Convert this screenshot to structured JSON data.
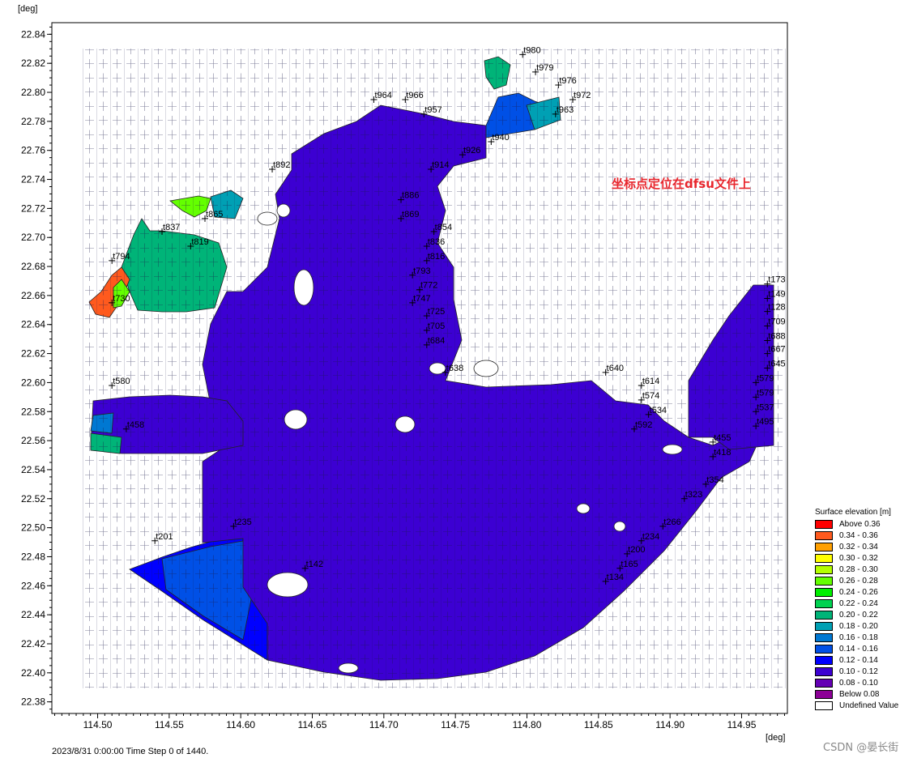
{
  "map": {
    "y_unit": "[deg]",
    "x_unit": "[deg]",
    "x_ticks": [
      "114.50",
      "114.55",
      "114.60",
      "114.65",
      "114.70",
      "114.75",
      "114.80",
      "114.85",
      "114.90",
      "114.95"
    ],
    "y_ticks": [
      "22.84",
      "22.82",
      "22.80",
      "22.78",
      "22.76",
      "22.74",
      "22.72",
      "22.70",
      "22.68",
      "22.66",
      "22.64",
      "22.62",
      "22.60",
      "22.58",
      "22.56",
      "22.54",
      "22.52",
      "22.50",
      "22.48",
      "22.46",
      "22.44",
      "22.42",
      "22.40",
      "22.38"
    ],
    "xlim": [
      114.468,
      114.982
    ],
    "ylim": [
      22.372,
      22.848
    ],
    "annotation": "坐标点定位在dfsu文件上",
    "point_labels": [
      {
        "text": "t980",
        "lon": 114.797,
        "lat": 22.826
      },
      {
        "text": "t979",
        "lon": 114.806,
        "lat": 22.814
      },
      {
        "text": "t976",
        "lon": 114.822,
        "lat": 22.805
      },
      {
        "text": "t972",
        "lon": 114.832,
        "lat": 22.795
      },
      {
        "text": "t963",
        "lon": 114.82,
        "lat": 22.785
      },
      {
        "text": "t966",
        "lon": 114.715,
        "lat": 22.795
      },
      {
        "text": "t964",
        "lon": 114.693,
        "lat": 22.795
      },
      {
        "text": "t957",
        "lon": 114.728,
        "lat": 22.785
      },
      {
        "text": "t940",
        "lon": 114.775,
        "lat": 22.766
      },
      {
        "text": "t926",
        "lon": 114.755,
        "lat": 22.757
      },
      {
        "text": "t914",
        "lon": 114.733,
        "lat": 22.747
      },
      {
        "text": "t892",
        "lon": 114.622,
        "lat": 22.747
      },
      {
        "text": "t886",
        "lon": 114.712,
        "lat": 22.726
      },
      {
        "text": "t869",
        "lon": 114.712,
        "lat": 22.713
      },
      {
        "text": "t865",
        "lon": 114.575,
        "lat": 22.713
      },
      {
        "text": "t854",
        "lon": 114.735,
        "lat": 22.704
      },
      {
        "text": "t837",
        "lon": 114.545,
        "lat": 22.704
      },
      {
        "text": "t836",
        "lon": 114.73,
        "lat": 22.694
      },
      {
        "text": "t819",
        "lon": 114.565,
        "lat": 22.694
      },
      {
        "text": "t816",
        "lon": 114.73,
        "lat": 22.684
      },
      {
        "text": "t794",
        "lon": 114.51,
        "lat": 22.684
      },
      {
        "text": "t793",
        "lon": 114.72,
        "lat": 22.674
      },
      {
        "text": "t772",
        "lon": 114.725,
        "lat": 22.664
      },
      {
        "text": "t747",
        "lon": 114.72,
        "lat": 22.655
      },
      {
        "text": "t730",
        "lon": 114.51,
        "lat": 22.655
      },
      {
        "text": "t725",
        "lon": 114.73,
        "lat": 22.646
      },
      {
        "text": "t705",
        "lon": 114.73,
        "lat": 22.636
      },
      {
        "text": "t684",
        "lon": 114.73,
        "lat": 22.626
      },
      {
        "text": "t638",
        "lon": 114.743,
        "lat": 22.607
      },
      {
        "text": "t580",
        "lon": 114.51,
        "lat": 22.598
      },
      {
        "text": "t640",
        "lon": 114.855,
        "lat": 22.607
      },
      {
        "text": "t614",
        "lon": 114.88,
        "lat": 22.598
      },
      {
        "text": "t574",
        "lon": 114.88,
        "lat": 22.588
      },
      {
        "text": "t534",
        "lon": 114.885,
        "lat": 22.578
      },
      {
        "text": "t592",
        "lon": 114.875,
        "lat": 22.568
      },
      {
        "text": "t458",
        "lon": 114.52,
        "lat": 22.568
      },
      {
        "text": "t455",
        "lon": 114.93,
        "lat": 22.559
      },
      {
        "text": "t418",
        "lon": 114.93,
        "lat": 22.549
      },
      {
        "text": "t354",
        "lon": 114.925,
        "lat": 22.53
      },
      {
        "text": "t323",
        "lon": 114.91,
        "lat": 22.52
      },
      {
        "text": "t266",
        "lon": 114.895,
        "lat": 22.501
      },
      {
        "text": "t235",
        "lon": 114.595,
        "lat": 22.501
      },
      {
        "text": "t234",
        "lon": 114.88,
        "lat": 22.491
      },
      {
        "text": "t201",
        "lon": 114.54,
        "lat": 22.491
      },
      {
        "text": "t200",
        "lon": 114.87,
        "lat": 22.482
      },
      {
        "text": "t165",
        "lon": 114.865,
        "lat": 22.472
      },
      {
        "text": "t142",
        "lon": 114.645,
        "lat": 22.472
      },
      {
        "text": "t134",
        "lon": 114.855,
        "lat": 22.463
      },
      {
        "text": "t173",
        "lon": 114.968,
        "lat": 22.668
      },
      {
        "text": "t149",
        "lon": 114.968,
        "lat": 22.658
      },
      {
        "text": "t128",
        "lon": 114.968,
        "lat": 22.649
      },
      {
        "text": "t709",
        "lon": 114.968,
        "lat": 22.639
      },
      {
        "text": "t688",
        "lon": 114.968,
        "lat": 22.629
      },
      {
        "text": "t667",
        "lon": 114.968,
        "lat": 22.62
      },
      {
        "text": "t645",
        "lon": 114.968,
        "lat": 22.61
      },
      {
        "text": "t579",
        "lon": 114.96,
        "lat": 22.6
      },
      {
        "text": "t579",
        "lon": 114.96,
        "lat": 22.59
      },
      {
        "text": "t537",
        "lon": 114.96,
        "lat": 22.58
      },
      {
        "text": "t495",
        "lon": 114.96,
        "lat": 22.57
      }
    ]
  },
  "legend": {
    "title": "Surface elevation [m]",
    "items": [
      {
        "label": "Above 0.36",
        "color": "#ff0000"
      },
      {
        "label": "0.34 - 0.36",
        "color": "#ff5a1e"
      },
      {
        "label": "0.32 - 0.34",
        "color": "#ffa000"
      },
      {
        "label": "0.30 - 0.32",
        "color": "#ffff00"
      },
      {
        "label": "0.28 - 0.30",
        "color": "#b4ff00"
      },
      {
        "label": "0.26 - 0.28",
        "color": "#64ff00"
      },
      {
        "label": "0.24 - 0.26",
        "color": "#00f000"
      },
      {
        "label": "0.22 - 0.24",
        "color": "#00d250"
      },
      {
        "label": "0.20 - 0.22",
        "color": "#00b478"
      },
      {
        "label": "0.18 - 0.20",
        "color": "#00a0b4"
      },
      {
        "label": "0.16 - 0.18",
        "color": "#0078d2"
      },
      {
        "label": "0.14 - 0.16",
        "color": "#0050e6"
      },
      {
        "label": "0.12 - 0.14",
        "color": "#0000ff"
      },
      {
        "label": "0.10 - 0.12",
        "color": "#3c00d2"
      },
      {
        "label": "0.08 - 0.10",
        "color": "#6400b4"
      },
      {
        "label": "Below 0.08",
        "color": "#8c0096"
      },
      {
        "label": "Undefined Value",
        "color": "#ffffff"
      }
    ]
  },
  "status": {
    "timestamp": "2023/8/31 0:00:00  Time Step 0 of 1440."
  },
  "watermark": "CSDN @晏长街"
}
